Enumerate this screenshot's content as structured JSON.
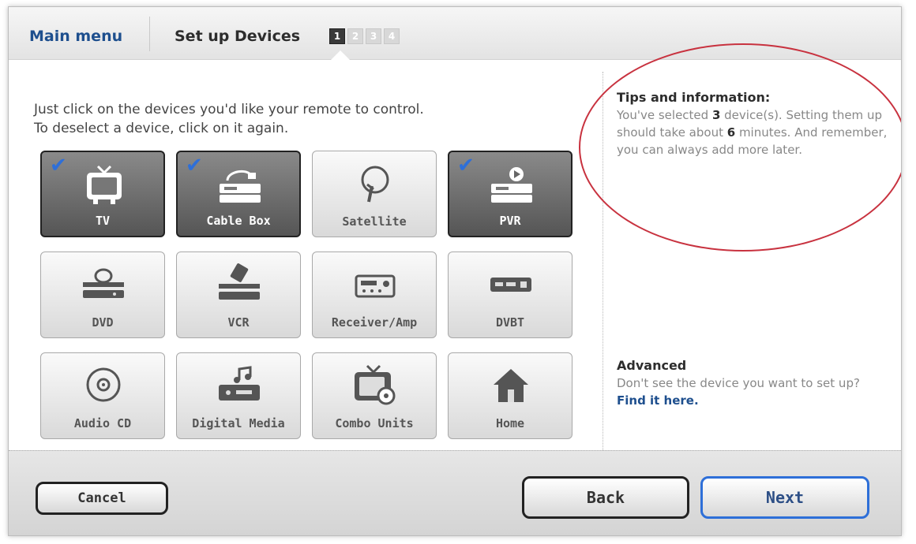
{
  "header": {
    "main_menu": "Main menu",
    "title": "Set up Devices",
    "steps": [
      "1",
      "2",
      "3",
      "4"
    ],
    "active_step": 1
  },
  "instructions": {
    "line1": "Just click on the devices you'd like your remote to control.",
    "line2": "To deselect a device, click on it again."
  },
  "devices": [
    {
      "label": "TV",
      "selected": true,
      "icon": "tv-icon"
    },
    {
      "label": "Cable Box",
      "selected": true,
      "icon": "cable-box-icon"
    },
    {
      "label": "Satellite",
      "selected": false,
      "icon": "satellite-icon"
    },
    {
      "label": "PVR",
      "selected": true,
      "icon": "pvr-icon"
    },
    {
      "label": "DVD",
      "selected": false,
      "icon": "dvd-icon"
    },
    {
      "label": "VCR",
      "selected": false,
      "icon": "vcr-icon"
    },
    {
      "label": "Receiver/Amp",
      "selected": false,
      "icon": "receiver-icon"
    },
    {
      "label": "DVBT",
      "selected": false,
      "icon": "dvbt-icon"
    },
    {
      "label": "Audio CD",
      "selected": false,
      "icon": "audio-cd-icon"
    },
    {
      "label": "Digital Media",
      "selected": false,
      "icon": "digital-media-icon"
    },
    {
      "label": "Combo Units",
      "selected": false,
      "icon": "combo-units-icon"
    },
    {
      "label": "Home",
      "selected": false,
      "icon": "home-icon"
    }
  ],
  "tips": {
    "title": "Tips and information:",
    "text_a": "You've selected ",
    "count": "3",
    "text_b": " device(s). Setting them up should take about ",
    "minutes": "6",
    "text_c": " minutes. And remember, you can always add more later."
  },
  "advanced": {
    "title": "Advanced",
    "text": "Don't see the device you want to set up?",
    "link": "Find it here."
  },
  "footer": {
    "cancel": "Cancel",
    "back": "Back",
    "next": "Next"
  },
  "colors": {
    "accent": "#2e6fd8",
    "link": "#1e4f8e",
    "annotation": "#c8323f"
  }
}
